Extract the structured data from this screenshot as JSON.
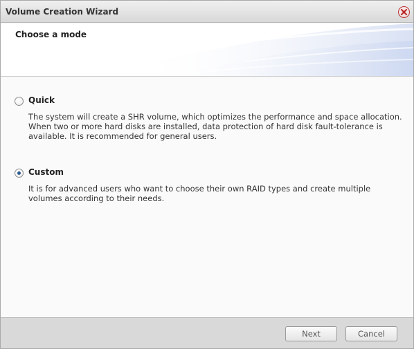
{
  "window": {
    "title": "Volume Creation Wizard"
  },
  "header": {
    "title": "Choose a mode"
  },
  "options": [
    {
      "label": "Quick",
      "checked": false,
      "description": "The system will create a SHR volume, which optimizes the performance and space allocation. When two or more hard disks are installed, data protection of hard disk fault-tolerance is available. It is recommended for general users."
    },
    {
      "label": "Custom",
      "checked": true,
      "description": "It is for advanced users who want to choose their own RAID types and create multiple volumes according to their needs."
    }
  ],
  "footer": {
    "next_label": "Next",
    "cancel_label": "Cancel"
  }
}
